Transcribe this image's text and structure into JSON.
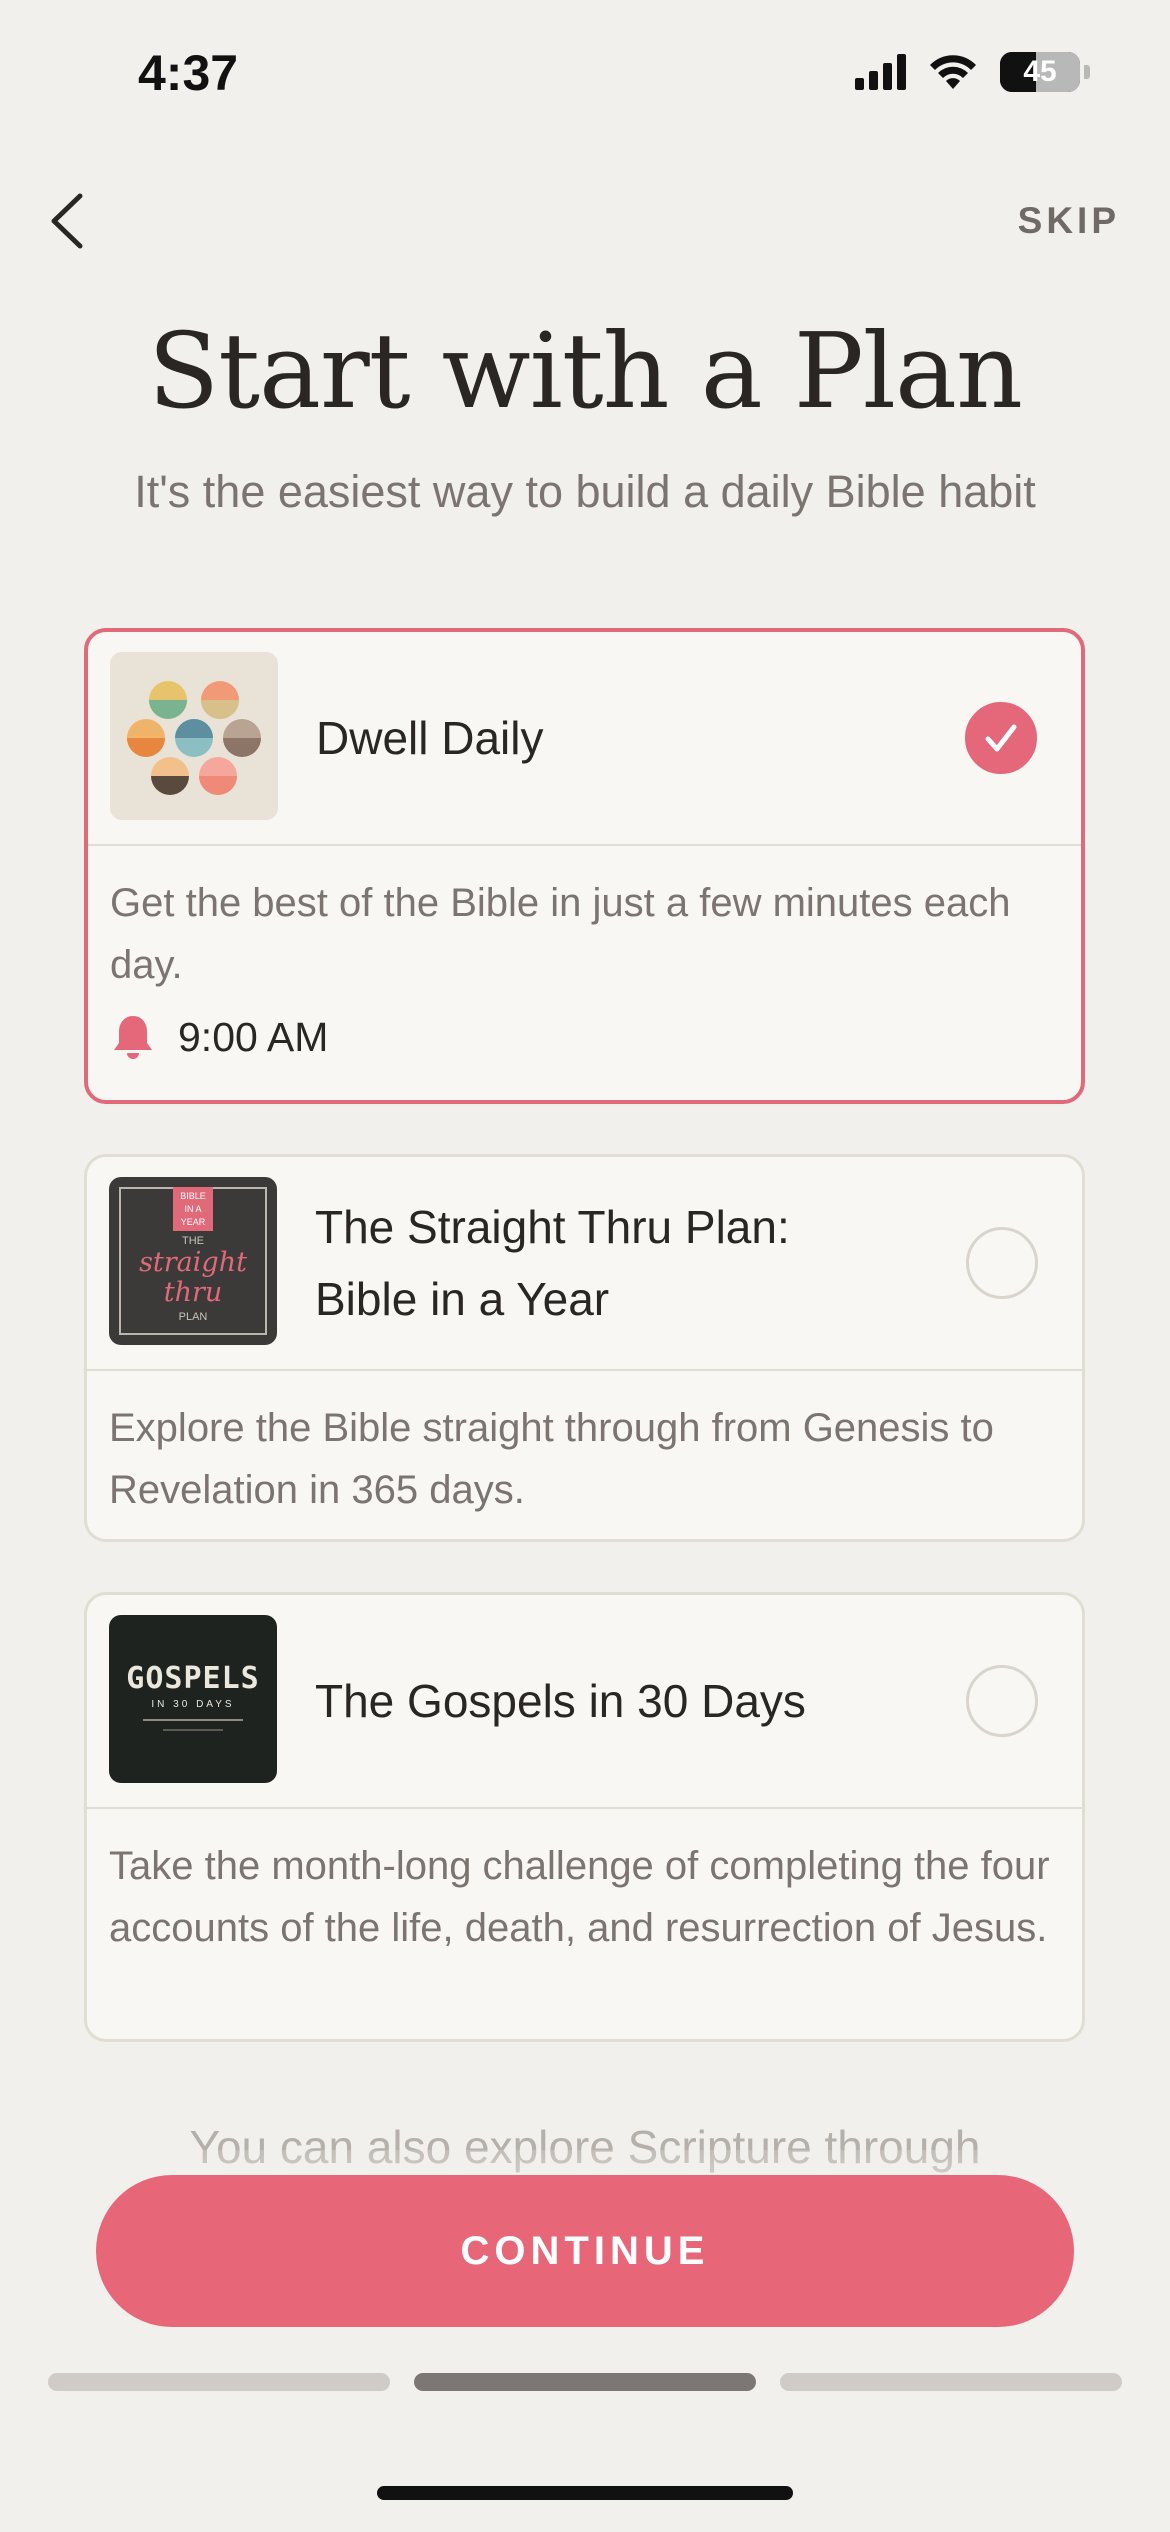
{
  "status_bar": {
    "time": "4:37",
    "battery": "45",
    "battery_level": 0.45
  },
  "header": {
    "back_icon": "chevron-left-icon",
    "skip_label": "SKIP"
  },
  "title": "Start with a Plan",
  "subtitle": "It's the easiest way to build a daily Bible habit",
  "plans": [
    {
      "name": "Dwell Daily",
      "description": "Get the best of the Bible in just a few minutes each day.",
      "selected": true,
      "reminder_icon": "bell-icon",
      "reminder_time": "9:00 AM"
    },
    {
      "name_line1": "The Straight Thru Plan:",
      "name_line2": "Bible in a Year",
      "description": "Explore the Bible straight through from Genesis to Revelation in 365 days.",
      "selected": false,
      "thumb_text": {
        "badge_top": "BIBLE",
        "badge_mid": "IN A",
        "badge_bottom": "YEAR",
        "the": "THE",
        "word1": "straight",
        "word2": "thru",
        "plan": "PLAN"
      }
    },
    {
      "name": "The Gospels in 30 Days",
      "description": "Take the month-long challenge of completing the four accounts of the life, death, and resurrection of Jesus.",
      "selected": false,
      "thumb_text": {
        "line1": "GOSPELS",
        "line2": "IN 30 DAYS"
      }
    }
  ],
  "footnote": "You can also explore Scripture through",
  "continue_label": "CONTINUE",
  "progress": {
    "total_steps": 3,
    "current_step": 2
  },
  "colors": {
    "accent": "#e76779",
    "background": "#f2f0ec",
    "card": "#f8f7f3"
  }
}
